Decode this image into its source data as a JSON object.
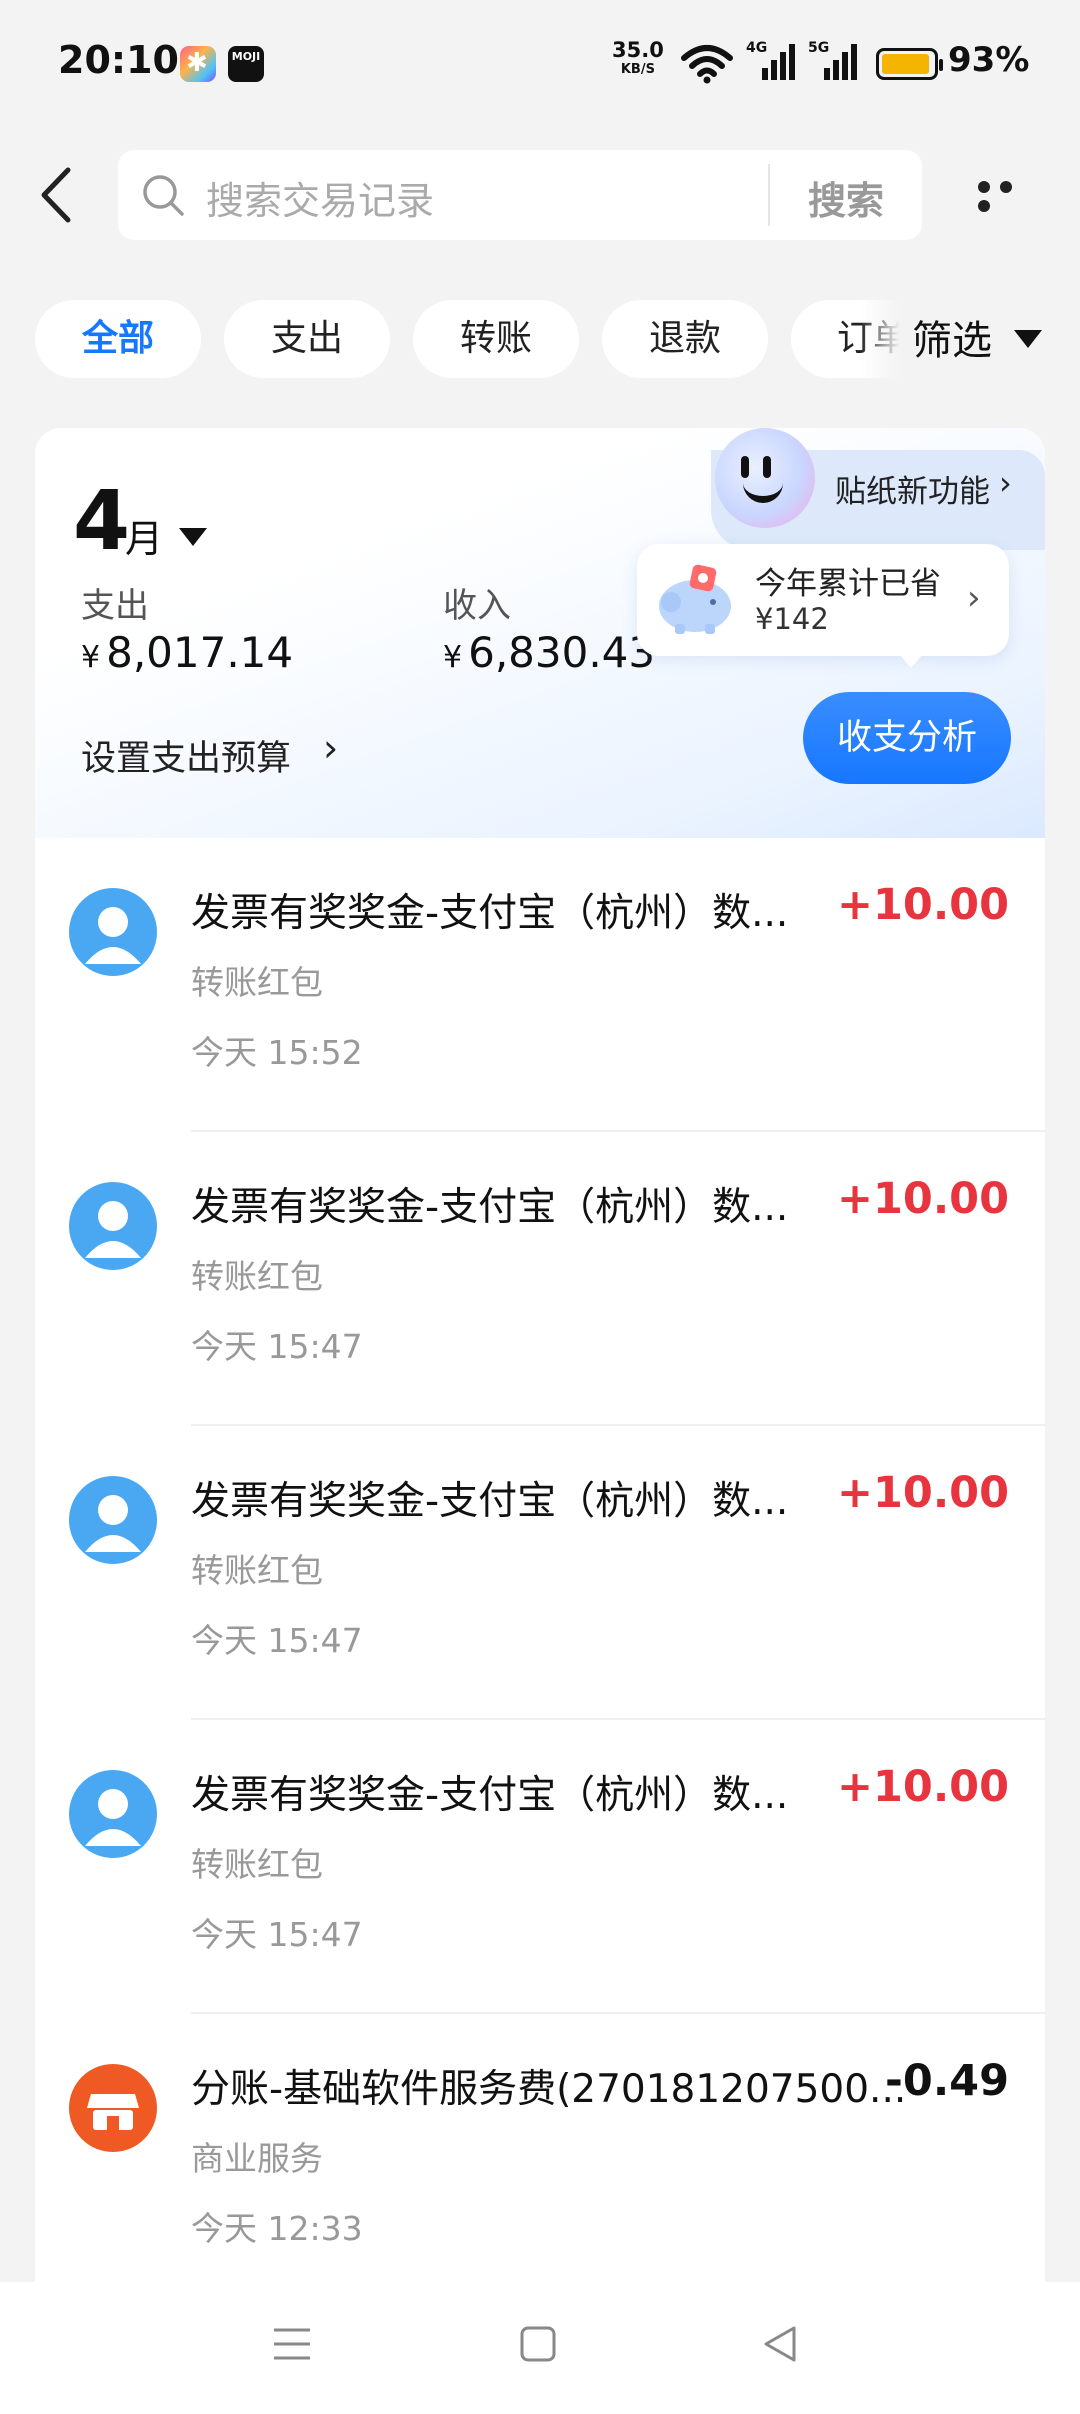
{
  "status_bar": {
    "time": "20:10",
    "app_badge": "MOJI",
    "net_speed": "35.0",
    "net_unit": "KB/S",
    "sig1": "4G",
    "sig2": "5G",
    "battery_level": 0.93,
    "battery": "93%",
    "battery_color": "#f5b400"
  },
  "header": {
    "search_placeholder": "搜索交易记录",
    "search_button": "搜索"
  },
  "tabs": [
    {
      "label": "全部",
      "active": true
    },
    {
      "label": "支出"
    },
    {
      "label": "转账"
    },
    {
      "label": "退款"
    },
    {
      "label": "订单"
    }
  ],
  "filter_label": "筛选",
  "summary": {
    "month": "4",
    "month_unit": "月",
    "sticker_label": "贴纸新功能",
    "expense_label": "支出",
    "expense_value": "8,017.14",
    "income_label": "收入",
    "income_value": "6,830.43",
    "currency": "¥",
    "saved_title": "今年累计已省",
    "saved_value": "¥142",
    "budget_label": "设置支出预算",
    "analysis_button": "收支分析"
  },
  "transactions": [
    {
      "title": "发票有奖奖金-支付宝（杭州）数...",
      "category": "转账红包",
      "time": "今天 15:52",
      "amount": "+10.00",
      "type": "person"
    },
    {
      "title": "发票有奖奖金-支付宝（杭州）数...",
      "category": "转账红包",
      "time": "今天 15:47",
      "amount": "+10.00",
      "type": "person"
    },
    {
      "title": "发票有奖奖金-支付宝（杭州）数...",
      "category": "转账红包",
      "time": "今天 15:47",
      "amount": "+10.00",
      "type": "person"
    },
    {
      "title": "发票有奖奖金-支付宝（杭州）数...",
      "category": "转账红包",
      "time": "今天 15:47",
      "amount": "+10.00",
      "type": "person"
    },
    {
      "title": "分账-基础软件服务费(270181207500...",
      "category": "商业服务",
      "time": "今天 12:33",
      "amount": "-0.49",
      "type": "shop"
    }
  ],
  "colors": {
    "accent": "#1677ff",
    "income": "#e8343f",
    "avatar_person": "#4aa8f2",
    "avatar_shop": "#ef5a24"
  }
}
